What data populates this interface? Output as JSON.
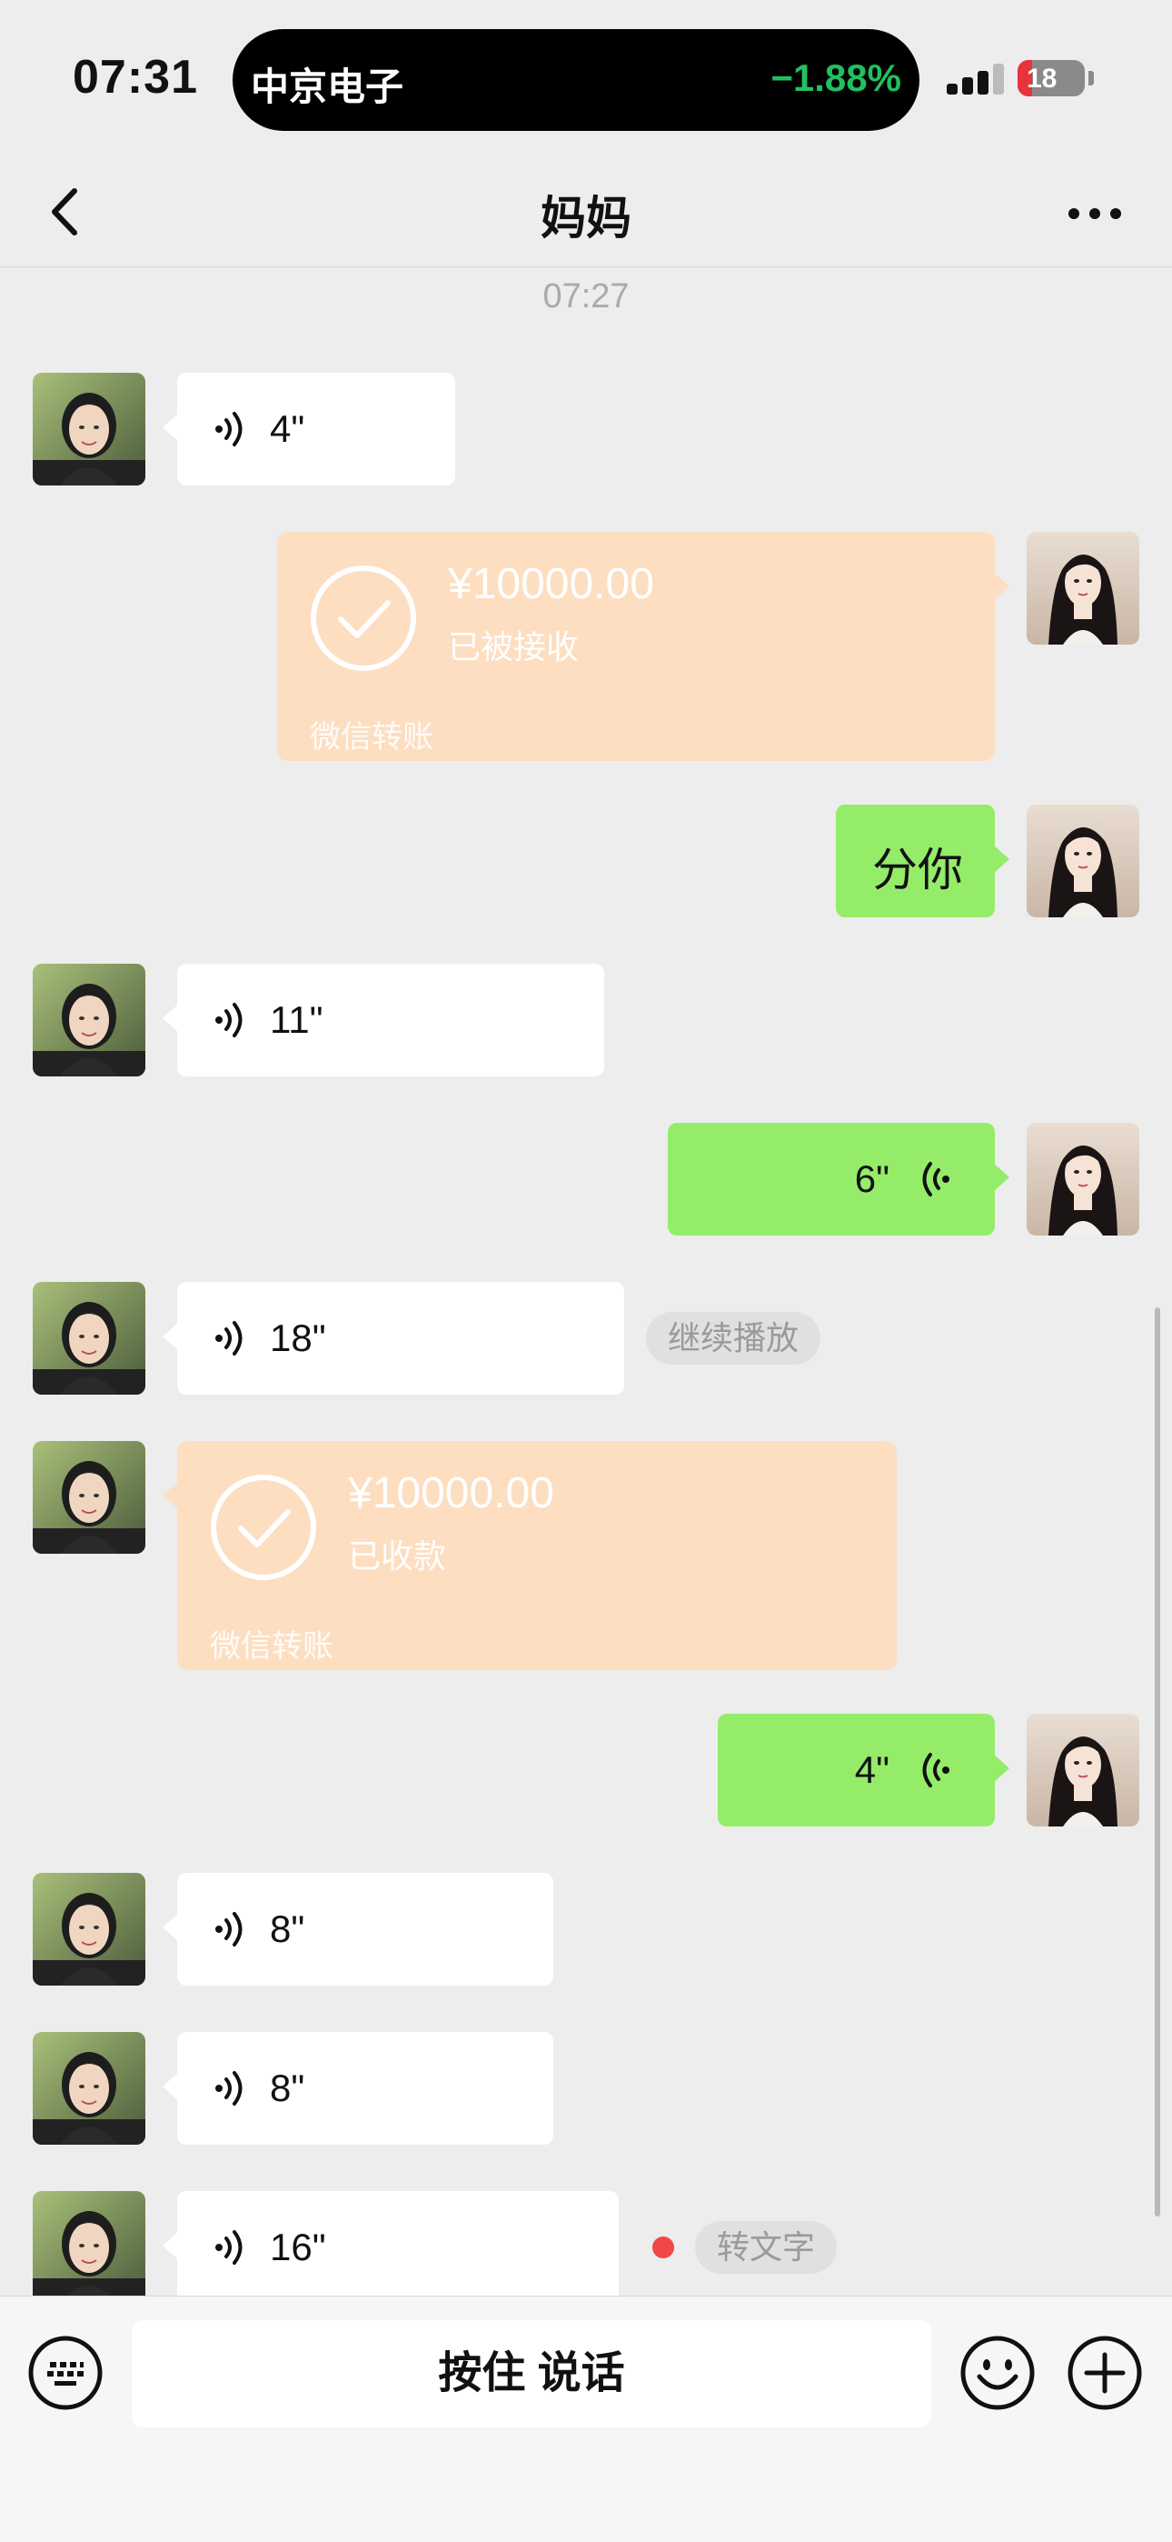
{
  "status_bar": {
    "time": "07:31",
    "island_name": "中京电子",
    "island_change": "−1.88%",
    "battery": "18"
  },
  "nav": {
    "title": "妈妈",
    "back_icon": "chevron-left-icon",
    "more_icon": "more-icon"
  },
  "chat": {
    "timestamp": "07:27",
    "messages": [
      {
        "side": "left",
        "type": "voice",
        "duration": "4\""
      },
      {
        "side": "right",
        "type": "transfer",
        "amount": "¥10000.00",
        "status": "已被接收",
        "footer": "微信转账"
      },
      {
        "side": "right",
        "type": "text",
        "text": "分你"
      },
      {
        "side": "left",
        "type": "voice",
        "duration": "11\""
      },
      {
        "side": "right",
        "type": "voice",
        "duration": "6\""
      },
      {
        "side": "left",
        "type": "voice",
        "duration": "18\"",
        "action": "继续播放"
      },
      {
        "side": "left",
        "type": "transfer",
        "amount": "¥10000.00",
        "status": "已收款",
        "footer": "微信转账"
      },
      {
        "side": "right",
        "type": "voice",
        "duration": "4\""
      },
      {
        "side": "left",
        "type": "voice",
        "duration": "8\""
      },
      {
        "side": "left",
        "type": "voice",
        "duration": "8\""
      },
      {
        "side": "left",
        "type": "voice",
        "duration": "16\"",
        "action": "转文字",
        "unread": true
      }
    ]
  },
  "input_bar": {
    "hold_to_talk": "按住 说话",
    "keyboard_icon": "keyboard-icon",
    "emoji_icon": "emoji-icon",
    "plus_icon": "plus-icon"
  },
  "colors": {
    "background": "#ededed",
    "green_bubble": "#95ec69",
    "transfer_bubble": "#fddec1",
    "stock_change": "#20c060"
  }
}
